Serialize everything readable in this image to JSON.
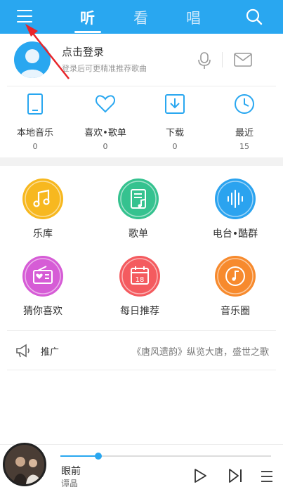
{
  "header": {
    "tabs": [
      {
        "label": "听",
        "active": true
      },
      {
        "label": "看",
        "active": false
      },
      {
        "label": "唱",
        "active": false
      }
    ],
    "bg_color": "#29a7f0"
  },
  "profile": {
    "login_title": "点击登录",
    "login_subtitle": "登录后可更精准推荐歌曲"
  },
  "quick_items": [
    {
      "label": "本地音乐",
      "count": "0",
      "icon": "phone-icon"
    },
    {
      "label": "喜欢•歌单",
      "count": "0",
      "icon": "heart-icon"
    },
    {
      "label": "下载",
      "count": "0",
      "icon": "download-icon"
    },
    {
      "label": "最近",
      "count": "15",
      "icon": "clock-icon"
    }
  ],
  "grid": [
    {
      "label": "乐库",
      "icon": "music-note-icon",
      "color": "#f7b81f"
    },
    {
      "label": "歌单",
      "icon": "playlist-icon",
      "color": "#35c28f"
    },
    {
      "label": "电台•酷群",
      "icon": "soundwave-icon",
      "color": "#2ba3ef"
    },
    {
      "label": "猜你喜欢",
      "icon": "radio-heart-icon",
      "color": "#d65cd6"
    },
    {
      "label": "每日推荐",
      "icon": "calendar-icon",
      "calendar_day": "18",
      "color": "#f45b5f"
    },
    {
      "label": "音乐圈",
      "icon": "music-circle-icon",
      "color": "#f78a2d"
    }
  ],
  "promo": {
    "label": "推广",
    "text": "《唐风遗韵》纵览大唐，盛世之歌"
  },
  "player": {
    "song_title": "眼前",
    "artist": "谭晶",
    "progress": 0.18
  }
}
